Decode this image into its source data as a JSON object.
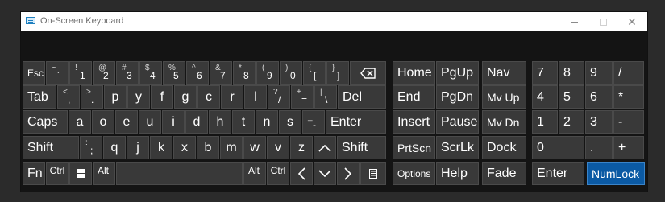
{
  "window": {
    "title": "On-Screen Keyboard",
    "controls": {
      "minimize": "–",
      "maximize": "",
      "close": "✕"
    }
  },
  "colors": {
    "key_bg": "#393939",
    "active_key_bg": "#0b5aa4",
    "board_bg": "#141414",
    "title_bg": "#ffffff"
  },
  "keys": {
    "esc": "Esc",
    "tilde": {
      "shift": "~",
      "main": "`"
    },
    "k1": {
      "shift": "!",
      "main": "1"
    },
    "k2": {
      "shift": "@",
      "main": "2"
    },
    "k3": {
      "shift": "#",
      "main": "3"
    },
    "k4": {
      "shift": "$",
      "main": "4"
    },
    "k5": {
      "shift": "%",
      "main": "5"
    },
    "k6": {
      "shift": "^",
      "main": "6"
    },
    "k7": {
      "shift": "&",
      "main": "7"
    },
    "k8": {
      "shift": "*",
      "main": "8"
    },
    "k9": {
      "shift": "(",
      "main": "9"
    },
    "k0": {
      "shift": ")",
      "main": "0"
    },
    "lbracket": {
      "shift": "{",
      "main": "["
    },
    "rbracket": {
      "shift": "}",
      "main": "]"
    },
    "backspace_icon": "backspace-icon",
    "tab": "Tab",
    "comma": {
      "shift": "<",
      "main": ","
    },
    "period": {
      "shift": ">",
      "main": "."
    },
    "p": "p",
    "y": "y",
    "f": "f",
    "g": "g",
    "c": "c",
    "r": "r",
    "l": "l",
    "slash": {
      "shift": "?",
      "main": "/"
    },
    "equals": {
      "shift": "+",
      "main": "="
    },
    "pipe": {
      "shift": "|",
      "main": "\\"
    },
    "del": "Del",
    "caps": "Caps",
    "a": "a",
    "o": "o",
    "e": "e",
    "u": "u",
    "i": "i",
    "d": "d",
    "h": "h",
    "t": "t",
    "n": "n",
    "s": "s",
    "minus": {
      "shift": "_",
      "main": "-"
    },
    "enter": "Enter",
    "shift": "Shift",
    "semicolon": {
      "shift": ":",
      "main": ";"
    },
    "q": "q",
    "j": "j",
    "k": "k",
    "x": "x",
    "b": "b",
    "m": "m",
    "w": "w",
    "v": "v",
    "z": "z",
    "up_icon": "chevron-up-icon",
    "shift_r": "Shift",
    "fn": "Fn",
    "ctrl": "Ctrl",
    "win_icon": "windows-icon",
    "alt": "Alt",
    "alt_r": "Alt",
    "ctrl_r": "Ctrl",
    "left_icon": "chevron-left-icon",
    "down_icon": "chevron-down-icon",
    "right_icon": "chevron-right-icon",
    "menu_icon": "context-menu-icon",
    "home": "Home",
    "pgup": "PgUp",
    "nav": "Nav",
    "end": "End",
    "pgdn": "PgDn",
    "mvup": "Mv Up",
    "insert": "Insert",
    "pause": "Pause",
    "mvdn": "Mv Dn",
    "prtscn": "PrtScn",
    "scrlk": "ScrLk",
    "dock": "Dock",
    "options": "Options",
    "help": "Help",
    "fade": "Fade",
    "num7": "7",
    "num8": "8",
    "num9": "9",
    "numdiv": "/",
    "num4": "4",
    "num5": "5",
    "num6": "6",
    "nummul": "*",
    "num1": "1",
    "num2": "2",
    "num3": "3",
    "numsub": "-",
    "num0": "0",
    "numdot": ".",
    "numadd": "+",
    "numenter": "Enter",
    "numlock": "NumLock"
  }
}
